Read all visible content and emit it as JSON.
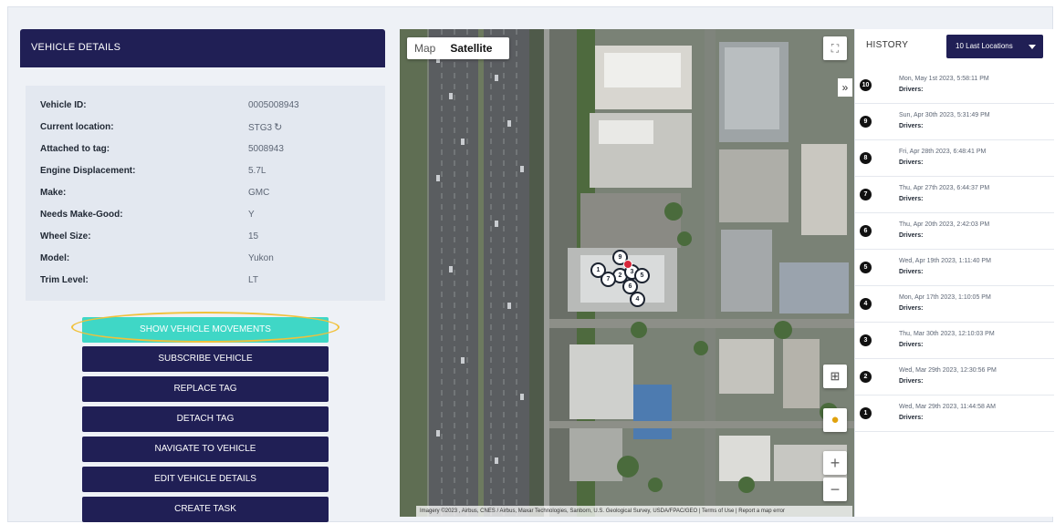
{
  "vehicle_details": {
    "title": "VEHICLE DETAILS",
    "fields": [
      {
        "label": "Vehicle ID:",
        "value": "0005008943"
      },
      {
        "label": "Current location:",
        "value": "STG3"
      },
      {
        "label": "Attached to tag:",
        "value": "5008943"
      },
      {
        "label": "Engine Displacement:",
        "value": "5.7L"
      },
      {
        "label": "Make:",
        "value": "GMC"
      },
      {
        "label": "Needs Make-Good:",
        "value": "Y"
      },
      {
        "label": "Wheel Size:",
        "value": "15"
      },
      {
        "label": "Model:",
        "value": "Yukon"
      },
      {
        "label": "Trim Level:",
        "value": "LT"
      }
    ],
    "refresh_icon": "refresh-icon"
  },
  "actions": {
    "show_movements": "SHOW VEHICLE MOVEMENTS",
    "subscribe": "SUBSCRIBE VEHICLE",
    "replace_tag": "REPLACE TAG",
    "detach_tag": "DETACH TAG",
    "navigate": "NAVIGATE TO VEHICLE",
    "edit": "EDIT VEHICLE DETAILS",
    "create_task": "CREATE TASK"
  },
  "map": {
    "type_map": "Map",
    "type_satellite": "Satellite",
    "selected_type": "Satellite",
    "zoom_in": "+",
    "zoom_out": "−",
    "attribution": "Imagery ©2023 , Airbus, CNES / Airbus, Maxar Technologies, Sanborn, U.S. Geological Survey, USDA/FPAC/GEO | Terms of Use | Report a map error",
    "pins": [
      "9",
      "1",
      "2",
      "3",
      "4",
      "5",
      "6",
      "7"
    ]
  },
  "history": {
    "title": "HISTORY",
    "selector": "10 Last Locations",
    "items": [
      {
        "num": "10",
        "date": "Mon, May 1st 2023, 5:58:11 PM",
        "drivers": "Drivers:"
      },
      {
        "num": "9",
        "date": "Sun, Apr 30th 2023, 5:31:49 PM",
        "drivers": "Drivers:"
      },
      {
        "num": "8",
        "date": "Fri, Apr 28th 2023, 6:48:41 PM",
        "drivers": "Drivers:"
      },
      {
        "num": "7",
        "date": "Thu, Apr 27th 2023, 6:44:37 PM",
        "drivers": "Drivers:"
      },
      {
        "num": "6",
        "date": "Thu, Apr 20th 2023, 2:42:03 PM",
        "drivers": "Drivers:"
      },
      {
        "num": "5",
        "date": "Wed, Apr 19th 2023, 1:11:40 PM",
        "drivers": "Drivers:"
      },
      {
        "num": "4",
        "date": "Mon, Apr 17th 2023, 1:10:05 PM",
        "drivers": "Drivers:"
      },
      {
        "num": "3",
        "date": "Thu, Mar 30th 2023, 12:10:03 PM",
        "drivers": "Drivers:"
      },
      {
        "num": "2",
        "date": "Wed, Mar 29th 2023, 12:30:56 PM",
        "drivers": "Drivers:"
      },
      {
        "num": "1",
        "date": "Wed, Mar 29th 2023, 11:44:58 AM",
        "drivers": "Drivers:"
      }
    ]
  },
  "colors": {
    "primary": "#201f55",
    "accent": "#3fd7c6",
    "highlight": "#f1c13a"
  }
}
